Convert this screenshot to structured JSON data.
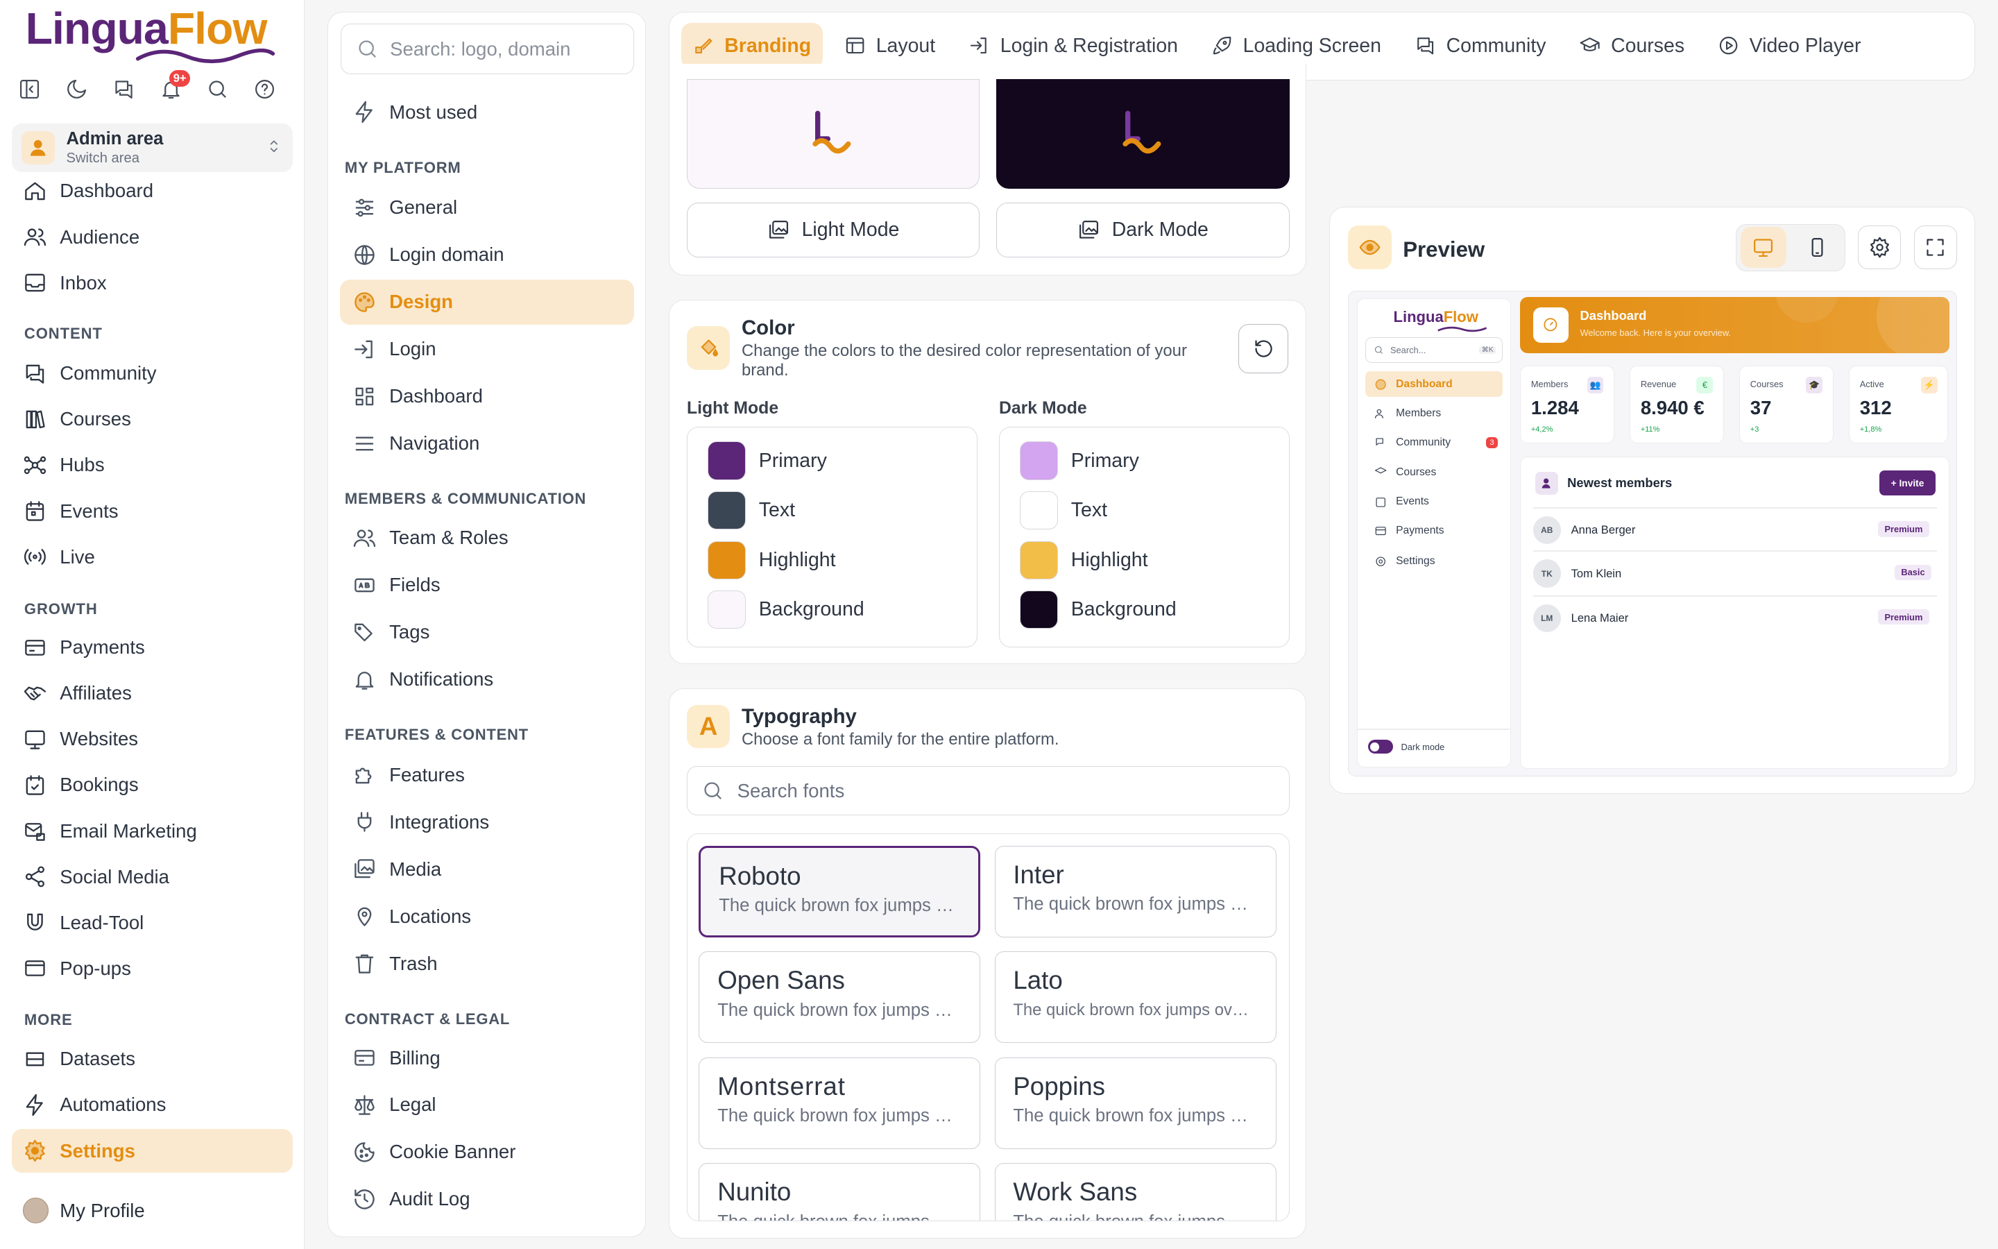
{
  "app": {
    "logo_part1": "Lingua",
    "logo_part2": "Flow",
    "notification_badge": "9+"
  },
  "admin": {
    "title": "Admin area",
    "subtitle": "Switch area"
  },
  "sidebar": {
    "main": [
      {
        "label": "Dashboard",
        "icon": "home-icon"
      },
      {
        "label": "Audience",
        "icon": "users-icon"
      },
      {
        "label": "Inbox",
        "icon": "inbox-icon"
      }
    ],
    "content_title": "CONTENT",
    "content": [
      {
        "label": "Community",
        "icon": "chat-icon"
      },
      {
        "label": "Courses",
        "icon": "books-icon"
      },
      {
        "label": "Hubs",
        "icon": "hub-icon"
      },
      {
        "label": "Events",
        "icon": "calendar-icon"
      },
      {
        "label": "Live",
        "icon": "broadcast-icon"
      }
    ],
    "growth_title": "GROWTH",
    "growth": [
      {
        "label": "Payments",
        "icon": "card-icon"
      },
      {
        "label": "Affiliates",
        "icon": "handshake-icon"
      },
      {
        "label": "Websites",
        "icon": "monitor-icon"
      },
      {
        "label": "Bookings",
        "icon": "calendar-check-icon"
      },
      {
        "label": "Email Marketing",
        "icon": "mail-icon"
      },
      {
        "label": "Social Media",
        "icon": "share-icon"
      },
      {
        "label": "Lead-Tool",
        "icon": "magnet-icon"
      },
      {
        "label": "Pop-ups",
        "icon": "window-icon"
      }
    ],
    "more_title": "MORE",
    "more": [
      {
        "label": "Datasets",
        "icon": "layers-icon"
      },
      {
        "label": "Automations",
        "icon": "bolt-icon"
      },
      {
        "label": "Settings",
        "icon": "gear-icon"
      }
    ],
    "profile": "My Profile"
  },
  "settings_nav": {
    "search_placeholder": "Search: logo, domain",
    "most_used": "Most used",
    "platform_title": "MY PLATFORM",
    "platform": [
      "General",
      "Login domain",
      "Design",
      "Login",
      "Dashboard",
      "Navigation"
    ],
    "members_title": "MEMBERS & COMMUNICATION",
    "members": [
      "Team & Roles",
      "Fields",
      "Tags",
      "Notifications"
    ],
    "features_title": "FEATURES & CONTENT",
    "features": [
      "Features",
      "Integrations",
      "Media",
      "Locations",
      "Trash"
    ],
    "contract_title": "CONTRACT & LEGAL",
    "contract": [
      "Billing",
      "Legal",
      "Cookie Banner",
      "Audit Log"
    ]
  },
  "tabs": [
    "Branding",
    "Layout",
    "Login & Registration",
    "Loading Screen",
    "Community",
    "Courses",
    "Video Player"
  ],
  "logo_modes": {
    "light": "Light Mode",
    "dark": "Dark Mode"
  },
  "color": {
    "title": "Color",
    "subtitle": "Change the colors to the desired color representation of your brand.",
    "light_title": "Light Mode",
    "dark_title": "Dark Mode",
    "light": [
      {
        "label": "Primary",
        "hex": "#5b2578"
      },
      {
        "label": "Text",
        "hex": "#3a4654"
      },
      {
        "label": "Highlight",
        "hex": "#e38e12"
      },
      {
        "label": "Background",
        "hex": "#faf6fb"
      }
    ],
    "dark": [
      {
        "label": "Primary",
        "hex": "#d3a4ef"
      },
      {
        "label": "Text",
        "hex": "#ffffff"
      },
      {
        "label": "Highlight",
        "hex": "#f3be47"
      },
      {
        "label": "Background",
        "hex": "#12071c"
      }
    ]
  },
  "typography": {
    "title": "Typography",
    "subtitle": "Choose a font family for the entire platform.",
    "search_placeholder": "Search fonts",
    "fonts": [
      {
        "name": "Roboto",
        "sample": "The quick brown fox jumps over the lazy dog"
      },
      {
        "name": "Inter",
        "sample": "The quick brown fox jumps over the lazy dog"
      },
      {
        "name": "Open Sans",
        "sample": "The quick brown fox jumps over the lazy dog"
      },
      {
        "name": "Lato",
        "sample": "The quick brown fox jumps over the lazy dog"
      },
      {
        "name": "Montserrat",
        "sample": "The quick brown fox jumps over the lazy dog"
      },
      {
        "name": "Poppins",
        "sample": "The quick brown fox jumps over the lazy dog"
      },
      {
        "name": "Nunito",
        "sample": "The quick brown fox jumps over the lazy dog"
      },
      {
        "name": "Work Sans",
        "sample": "The quick brown fox jumps over the lazy dog"
      }
    ],
    "selected": "Roboto"
  },
  "preview": {
    "title": "Preview",
    "mini": {
      "logo1": "Lingua",
      "logo2": "Flow",
      "search": "Search...",
      "kbd": "⌘K",
      "nav": [
        "Dashboard",
        "Members",
        "Community",
        "Courses",
        "Events",
        "Payments",
        "Settings"
      ],
      "community_badge": "3",
      "dark_mode": "Dark mode",
      "banner_title": "Dashboard",
      "banner_sub": "Welcome back. Here is your overview.",
      "stats": [
        {
          "label": "Members",
          "value": "1.284",
          "delta": "+4,2%"
        },
        {
          "label": "Revenue",
          "value": "8.940 €",
          "delta": "+11%"
        },
        {
          "label": "Courses",
          "value": "37",
          "delta": "+3"
        },
        {
          "label": "Active",
          "value": "312",
          "delta": "+1,8%"
        }
      ],
      "newest_title": "Newest members",
      "invite": "+ Invite",
      "members": [
        {
          "initials": "AB",
          "name": "Anna Berger",
          "tag": "Premium"
        },
        {
          "initials": "TK",
          "name": "Tom Klein",
          "tag": "Basic"
        },
        {
          "initials": "LM",
          "name": "Lena Maier",
          "tag": "Premium"
        }
      ]
    }
  }
}
